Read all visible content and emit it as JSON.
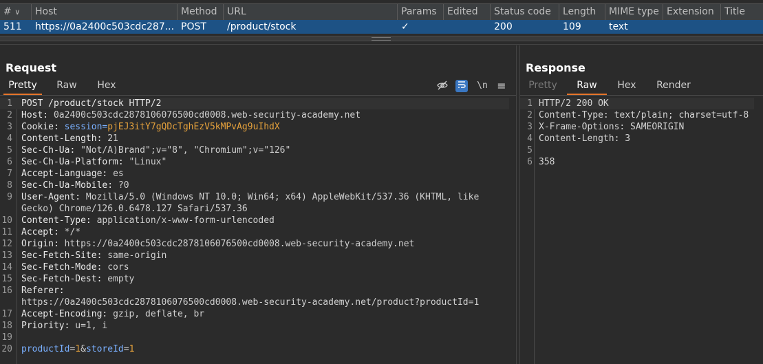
{
  "table": {
    "columns": [
      {
        "label": "#",
        "sort": "∨"
      },
      {
        "label": "Host"
      },
      {
        "label": "Method"
      },
      {
        "label": "URL"
      },
      {
        "label": "Params"
      },
      {
        "label": "Edited"
      },
      {
        "label": "Status code"
      },
      {
        "label": "Length"
      },
      {
        "label": "MIME type"
      },
      {
        "label": "Extension"
      },
      {
        "label": "Title"
      }
    ],
    "row": {
      "num": "511",
      "host": "https://0a2400c503cdc287...",
      "method": "POST",
      "url": "/product/stock",
      "params": "✓",
      "edited": "",
      "status": "200",
      "length": "109",
      "mime": "text",
      "extension": "",
      "title": ""
    }
  },
  "request": {
    "title": "Request",
    "tabs": [
      "Pretty",
      "Raw",
      "Hex"
    ],
    "active_tab": "Pretty",
    "tools": [
      "eye-off-icon",
      "wrap-icon",
      "\\n",
      "menu-icon"
    ],
    "lines": [
      {
        "n": "1",
        "key": "POST /product/stock HTTP/2",
        "val": ""
      },
      {
        "n": "2",
        "key": "Host: ",
        "val": "0a2400c503cdc2878106076500cd0008.web-security-academy.net"
      },
      {
        "n": "3",
        "key": "Cookie: ",
        "val": "session=",
        "cookie": "pjEJ3itY7gQDcTghEzV5kMPvAg9uIhdX"
      },
      {
        "n": "4",
        "key": "Content-Length: ",
        "val": "21"
      },
      {
        "n": "5",
        "key": "Sec-Ch-Ua: ",
        "val": "\"Not/A)Brand\";v=\"8\", \"Chromium\";v=\"126\""
      },
      {
        "n": "6",
        "key": "Sec-Ch-Ua-Platform: ",
        "val": "\"Linux\""
      },
      {
        "n": "7",
        "key": "Accept-Language: ",
        "val": "es"
      },
      {
        "n": "8",
        "key": "Sec-Ch-Ua-Mobile: ",
        "val": "?0"
      },
      {
        "n": "9",
        "key": "User-Agent: ",
        "val": "Mozilla/5.0 (Windows NT 10.0; Win64; x64) AppleWebKit/537.36 (KHTML, like"
      },
      {
        "n": "",
        "key": "",
        "val": "Gecko) Chrome/126.0.6478.127 Safari/537.36"
      },
      {
        "n": "10",
        "key": "Content-Type: ",
        "val": "application/x-www-form-urlencoded"
      },
      {
        "n": "11",
        "key": "Accept: ",
        "val": "*/*"
      },
      {
        "n": "12",
        "key": "Origin: ",
        "val": "https://0a2400c503cdc2878106076500cd0008.web-security-academy.net"
      },
      {
        "n": "13",
        "key": "Sec-Fetch-Site: ",
        "val": "same-origin"
      },
      {
        "n": "14",
        "key": "Sec-Fetch-Mode: ",
        "val": "cors"
      },
      {
        "n": "15",
        "key": "Sec-Fetch-Dest: ",
        "val": "empty"
      },
      {
        "n": "16",
        "key": "Referer: ",
        "val": ""
      },
      {
        "n": "",
        "key": "",
        "val": "https://0a2400c503cdc2878106076500cd0008.web-security-academy.net/product?productId=1"
      },
      {
        "n": "17",
        "key": "Accept-Encoding: ",
        "val": "gzip, deflate, br"
      },
      {
        "n": "18",
        "key": "Priority: ",
        "val": "u=1, i"
      },
      {
        "n": "19",
        "key": "",
        "val": ""
      },
      {
        "n": "20",
        "key": "",
        "val": "",
        "body": [
          "productId",
          "=",
          "1",
          "&",
          "storeId",
          "=",
          "1"
        ]
      }
    ]
  },
  "response": {
    "title": "Response",
    "tabs": [
      "Pretty",
      "Raw",
      "Hex",
      "Render"
    ],
    "active_tab": "Raw",
    "lines": [
      {
        "n": "1",
        "text": "HTTP/2 200 OK"
      },
      {
        "n": "2",
        "text": "Content-Type: text/plain; charset=utf-8"
      },
      {
        "n": "3",
        "text": "X-Frame-Options: SAMEORIGIN"
      },
      {
        "n": "4",
        "text": "Content-Length: 3"
      },
      {
        "n": "5",
        "text": ""
      },
      {
        "n": "6",
        "text": "358"
      }
    ]
  }
}
